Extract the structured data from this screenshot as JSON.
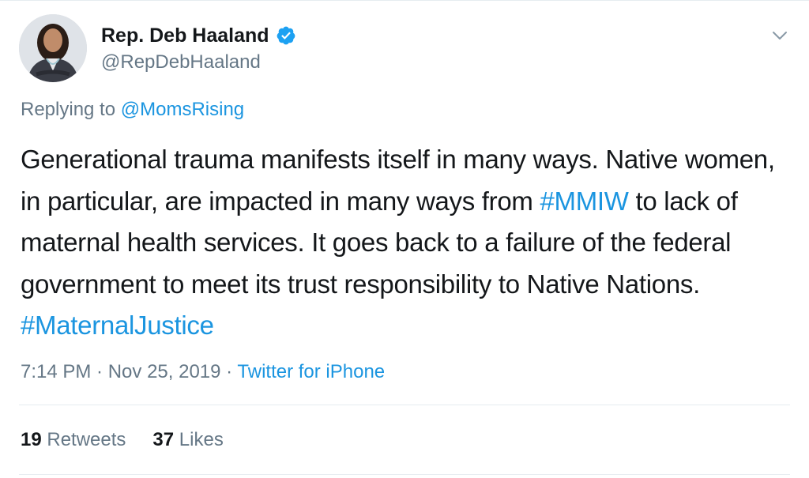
{
  "author": {
    "display_name": "Rep. Deb Haaland",
    "handle": "@RepDebHaaland",
    "verified": true,
    "avatar_icon": "profile-photo"
  },
  "reply": {
    "prefix": "Replying to ",
    "mention": "@MomsRising"
  },
  "tweet": {
    "text_1": "Generational trauma manifests itself in many ways. Native women, in particular, are impacted in many ways from ",
    "hashtag_1": "#MMIW",
    "text_2": " to lack of maternal health services. It goes back to a failure of the federal government to meet its trust responsibility to Native Nations. ",
    "hashtag_2": "#MaternalJustice"
  },
  "meta": {
    "time": "7:14 PM",
    "separator": " · ",
    "date": "Nov 25, 2019",
    "separator_2": " · ",
    "source": "Twitter for iPhone"
  },
  "stats": {
    "retweets_count": "19",
    "retweets_label": " Retweets",
    "likes_count": "37",
    "likes_label": " Likes"
  },
  "colors": {
    "link": "#1b95e0",
    "secondary": "#657786",
    "primary_text": "#14171a",
    "verified_badge": "#1da1f2",
    "divider": "#e6ecf0"
  }
}
